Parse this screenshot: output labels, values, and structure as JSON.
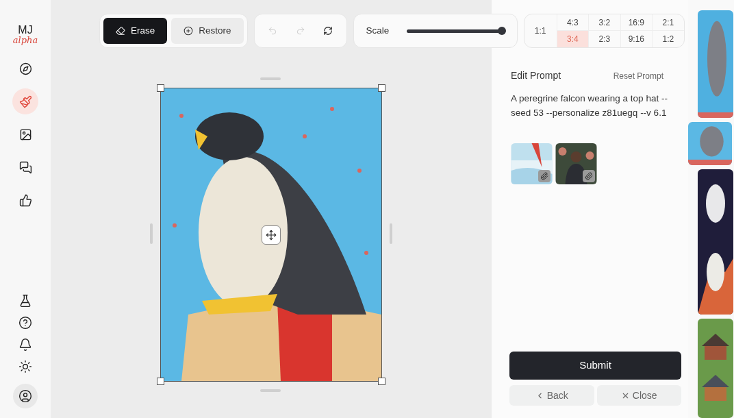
{
  "logo": {
    "title": "MJ",
    "subtitle": "alpha"
  },
  "nav": [
    {
      "kind": "explore",
      "selected": false
    },
    {
      "kind": "edit",
      "selected": true
    },
    {
      "kind": "images",
      "selected": false
    },
    {
      "kind": "chat",
      "selected": false
    },
    {
      "kind": "rate",
      "selected": false
    }
  ],
  "nav_bottom": [
    {
      "kind": "lab"
    },
    {
      "kind": "help"
    },
    {
      "kind": "notifications"
    },
    {
      "kind": "theme"
    },
    {
      "kind": "account"
    }
  ],
  "toolbar": {
    "modes": [
      {
        "kind": "erase",
        "label": "Erase",
        "selected": true
      },
      {
        "kind": "restore",
        "label": "Restore",
        "selected": false
      }
    ],
    "history": [
      {
        "kind": "undo",
        "disabled": true
      },
      {
        "kind": "redo",
        "disabled": true
      },
      {
        "kind": "refresh",
        "disabled": false
      }
    ],
    "scale": {
      "label": "Scale",
      "level": 1
    },
    "aspect_square": {
      "label": "1:1",
      "selected": false
    },
    "aspect_ratios": [
      {
        "label": "4:3",
        "selected": false
      },
      {
        "label": "3:2",
        "selected": false
      },
      {
        "label": "16:9",
        "selected": false
      },
      {
        "label": "2:1",
        "selected": false
      },
      {
        "label": "3:4",
        "selected": true
      },
      {
        "label": "2:3",
        "selected": false
      },
      {
        "label": "9:16",
        "selected": false
      },
      {
        "label": "1:2",
        "selected": false
      }
    ]
  },
  "editor": {
    "title": "Edit Prompt",
    "reset": "Reset Prompt",
    "prompt": "A peregrine falcon wearing a top hat --seed 53 --personalize z81uegq --v 6.1",
    "references": [
      {
        "kind": "picture"
      },
      {
        "kind": "picture"
      }
    ]
  },
  "actions": {
    "submit": "Submit",
    "back": "Back",
    "close": "Close"
  },
  "thumbnails": [
    {
      "kind": "picture",
      "selected": false
    },
    {
      "kind": "picture",
      "selected": true
    },
    {
      "kind": "picture",
      "selected": false
    },
    {
      "kind": "picture",
      "selected": false
    }
  ]
}
